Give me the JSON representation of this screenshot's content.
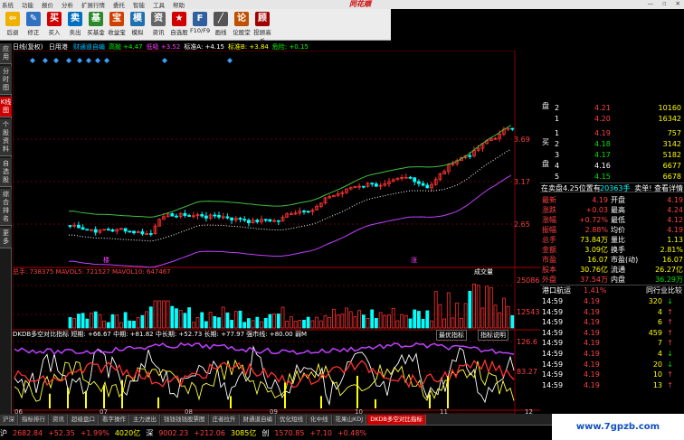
{
  "menu": {
    "items": [
      "系统",
      "功能",
      "报价",
      "分析",
      "扩展行情",
      "委托",
      "智能",
      "工具",
      "帮助"
    ],
    "logo": "同花顺",
    "window": [
      "—",
      "▫",
      "✕"
    ]
  },
  "toolbar": {
    "buttons": [
      {
        "label": "后退",
        "icon": "back-icon",
        "glyph": "⇦",
        "color": "#f0b000"
      },
      {
        "label": "修正",
        "icon": "edit-icon",
        "glyph": "✎",
        "color": "#3070c0"
      },
      {
        "label": "买入",
        "icon": "buy-icon",
        "glyph": "买",
        "color": "#d00000"
      },
      {
        "label": "卖出",
        "icon": "sell-icon",
        "glyph": "卖",
        "color": "#0070c0"
      },
      {
        "label": "买基金",
        "icon": "fund-icon",
        "glyph": "基",
        "color": "#2a8a2a"
      },
      {
        "label": "收益宝",
        "icon": "yield-icon",
        "glyph": "宝",
        "color": "#d04000"
      },
      {
        "label": "模拟",
        "icon": "simulate-icon",
        "glyph": "模",
        "color": "#2070b0"
      },
      {
        "label": "资讯",
        "icon": "news-icon",
        "glyph": "资",
        "color": "#666"
      },
      {
        "label": "自选股",
        "icon": "watchlist-icon",
        "glyph": "★",
        "color": "#d00000"
      },
      {
        "label": "F10/F9",
        "icon": "f10-icon",
        "glyph": "F",
        "color": "#3060a0"
      },
      {
        "label": "画线",
        "icon": "draw-icon",
        "glyph": "╱",
        "color": "#555"
      },
      {
        "label": "论股堂",
        "icon": "forum-icon",
        "glyph": "论",
        "color": "#c05000"
      },
      {
        "label": "投顾高手",
        "icon": "advisor-icon",
        "glyph": "顾",
        "color": "#a00000"
      }
    ]
  },
  "vtabs": [
    {
      "label": "应用"
    },
    {
      "label": "分时图"
    },
    {
      "label": "K线图",
      "active": true
    },
    {
      "label": "个股资料"
    },
    {
      "label": "自选股"
    },
    {
      "label": "综合排名"
    },
    {
      "label": "更多"
    }
  ],
  "chart": {
    "period": "日线(复权)",
    "ind_name": "日用港",
    "legend": [
      {
        "t": "财通道自编",
        "c": "#00c0ff"
      },
      {
        "t": "高抛 +4.47",
        "c": "#00ff00"
      },
      {
        "t": "低吸 +3.52",
        "c": "#ff40ff"
      },
      {
        "t": "标准A: +4.15",
        "c": "#fff"
      },
      {
        "t": "标准B: +3.84",
        "c": "#ffff00"
      },
      {
        "t": "危险: +0.15",
        "c": "#00ff00"
      }
    ],
    "price_ticks": [
      "3.69",
      "3.17",
      "2.65"
    ],
    "vol_legend": "总手: 738375   MAVOL5: 721527   MAVOL10: 647467",
    "vol_label": "成交量",
    "vol_ticks": [
      "25086",
      "12543"
    ],
    "ind_legend": "DKDB多空对比指标  短期: +66.67  中期: +81.82  中长期: +52.73  长期: +77.97  强市线: +80.00  弱M",
    "ind_btn1": "最优指标",
    "ind_btn2": "指标说明",
    "ind_ticks": [
      "126.6",
      "83.27"
    ],
    "dates": [
      "06",
      "07",
      "08",
      "09",
      "10",
      "11",
      "12"
    ],
    "markers": [
      "楼",
      "涨"
    ]
  },
  "quote": {
    "asks": [
      {
        "n": "2",
        "p": "4.21",
        "v": "10160"
      },
      {
        "n": "1",
        "p": "4.20",
        "v": "16342"
      }
    ],
    "side_sell": "盘",
    "side_buy": "买",
    "bids": [
      {
        "n": "1",
        "p": "4.19",
        "v": "757"
      },
      {
        "n": "2",
        "p": "4.18",
        "v": "3142"
      },
      {
        "n": "3",
        "p": "4.17",
        "v": "5182"
      },
      {
        "n": "4",
        "p": "4.16",
        "v": "6677"
      },
      {
        "n": "5",
        "p": "4.15",
        "v": "6678"
      }
    ],
    "info": {
      "left": "在卖盘4.25位置有",
      "mid": "20363手",
      "right": "卖单! 查看详情"
    },
    "stats": [
      {
        "l1": "最新",
        "v1": "4.19",
        "l2": "开盘",
        "v2": "4.19"
      },
      {
        "l1": "涨跌",
        "v1": "+0.03",
        "l2": "最高",
        "v2": "4.24"
      },
      {
        "l1": "涨幅",
        "v1": "+0.72%",
        "l2": "最低",
        "v2": "4.12"
      },
      {
        "l1": "振幅",
        "v1": "2.88%",
        "l2": "均价",
        "v2": "4.19"
      },
      {
        "l1": "总手",
        "v1": "73.84万",
        "l2": "量比",
        "v2": "1.13"
      },
      {
        "l1": "金额",
        "v1": "3.09亿",
        "l2": "换手",
        "v2": "2.81%"
      },
      {
        "l1": "市盈",
        "v1": "16.07",
        "l2": "市盈(动)",
        "v2": "16.07"
      },
      {
        "l1": "股本",
        "v1": "30.76亿",
        "l2": "流通",
        "v2": "26.27亿"
      },
      {
        "l1": "外盘",
        "v1": "37.54万",
        "l2": "内盘",
        "v2": "36.29万"
      }
    ],
    "sector": {
      "name": "港口航运",
      "pct": "1.41%",
      "rank": "同行业比较"
    },
    "ticks": [
      {
        "t": "14:59",
        "p": "4.19",
        "v": "320",
        "d": "down"
      },
      {
        "t": "14:59",
        "p": "4.19",
        "v": "4",
        "d": "up"
      },
      {
        "t": "14:59",
        "p": "4.19",
        "v": "6",
        "d": "up"
      },
      {
        "t": "14:59",
        "p": "4.19",
        "v": "459",
        "d": "up"
      },
      {
        "t": "14:59",
        "p": "4.19",
        "v": "7",
        "d": "up"
      },
      {
        "t": "14:59",
        "p": "4.19",
        "v": "4",
        "d": "down"
      },
      {
        "t": "14:59",
        "p": "4.19",
        "v": "20",
        "d": "down"
      },
      {
        "t": "14:59",
        "p": "4.19",
        "v": "10",
        "d": "up"
      },
      {
        "t": "14:59",
        "p": "4.19",
        "v": "13",
        "d": "up"
      }
    ]
  },
  "btabs": [
    {
      "label": "沪深"
    },
    {
      "label": "指标排行"
    },
    {
      "label": "资讯"
    },
    {
      "label": "超级盘口"
    },
    {
      "label": "看字操作"
    },
    {
      "label": "主力进出"
    },
    {
      "label": "钱钱钱钱股票图"
    },
    {
      "label": "庄者拉升"
    },
    {
      "label": "财通道自编"
    },
    {
      "label": "优化短线"
    },
    {
      "label": "化中线"
    },
    {
      "label": "花果山KDJ"
    },
    {
      "label": "DKDB多空对比指标",
      "active": true
    }
  ],
  "status": [
    {
      "t": "沪",
      "c": "#fff"
    },
    {
      "t": "2682.84",
      "c": "#ff4040"
    },
    {
      "t": "+52.35",
      "c": "#ff4040"
    },
    {
      "t": "+1.99%",
      "c": "#ff4040"
    },
    {
      "t": "4020亿",
      "c": "#ffff00"
    },
    {
      "t": "深",
      "c": "#fff"
    },
    {
      "t": "9002.23",
      "c": "#ff4040"
    },
    {
      "t": "+212.06",
      "c": "#ff4040"
    },
    {
      "t": "3085亿",
      "c": "#ffff00"
    },
    {
      "t": "创",
      "c": "#fff"
    },
    {
      "t": "1570.85",
      "c": "#ff4040"
    },
    {
      "t": "+7.10",
      "c": "#ff4040"
    },
    {
      "t": "+0.48%",
      "c": "#ff4040"
    }
  ],
  "watermark": "www.7gpzb.com"
}
